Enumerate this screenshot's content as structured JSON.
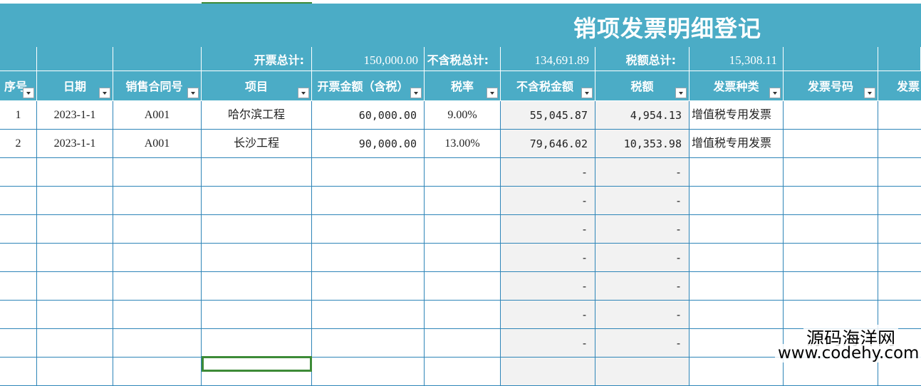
{
  "sheet_title": "销项发票明细登记",
  "summary": {
    "total_label": "开票总计:",
    "total_value": "150,000.00",
    "excl_tax_label": "不含税总计:",
    "excl_tax_value": "134,691.89",
    "tax_label": "税额总计:",
    "tax_value": "15,308.11"
  },
  "headers": {
    "seq": "序号",
    "date": "日期",
    "contract": "销售合同号",
    "project": "项目",
    "amount_incl": "开票金额（含税）",
    "rate": "税率",
    "amount_excl": "不含税金额",
    "tax": "税额",
    "invoice_type": "发票种类",
    "invoice_no": "发票号码",
    "more": "发票"
  },
  "rows": [
    {
      "seq": "1",
      "date": "2023-1-1",
      "contract": "A001",
      "project": "哈尔滨工程",
      "amount_incl": "60,000.00",
      "rate": "9.00%",
      "amount_excl": "55,045.87",
      "tax": "4,954.13",
      "invoice_type": "增值税专用发票",
      "invoice_no": "",
      "more": ""
    },
    {
      "seq": "2",
      "date": "2023-1-1",
      "contract": "A001",
      "project": "长沙工程",
      "amount_incl": "90,000.00",
      "rate": "13.00%",
      "amount_excl": "79,646.02",
      "tax": "10,353.98",
      "invoice_type": "增值税专用发票",
      "invoice_no": "",
      "more": ""
    },
    {
      "seq": "",
      "date": "",
      "contract": "",
      "project": "",
      "amount_incl": "",
      "rate": "",
      "amount_excl": "-",
      "tax": "-",
      "invoice_type": "",
      "invoice_no": "",
      "more": ""
    },
    {
      "seq": "",
      "date": "",
      "contract": "",
      "project": "",
      "amount_incl": "",
      "rate": "",
      "amount_excl": "-",
      "tax": "-",
      "invoice_type": "",
      "invoice_no": "",
      "more": ""
    },
    {
      "seq": "",
      "date": "",
      "contract": "",
      "project": "",
      "amount_incl": "",
      "rate": "",
      "amount_excl": "-",
      "tax": "-",
      "invoice_type": "",
      "invoice_no": "",
      "more": ""
    },
    {
      "seq": "",
      "date": "",
      "contract": "",
      "project": "",
      "amount_incl": "",
      "rate": "",
      "amount_excl": "-",
      "tax": "-",
      "invoice_type": "",
      "invoice_no": "",
      "more": ""
    },
    {
      "seq": "",
      "date": "",
      "contract": "",
      "project": "",
      "amount_incl": "",
      "rate": "",
      "amount_excl": "-",
      "tax": "-",
      "invoice_type": "",
      "invoice_no": "",
      "more": ""
    },
    {
      "seq": "",
      "date": "",
      "contract": "",
      "project": "",
      "amount_incl": "",
      "rate": "",
      "amount_excl": "-",
      "tax": "-",
      "invoice_type": "",
      "invoice_no": "",
      "more": ""
    },
    {
      "seq": "",
      "date": "",
      "contract": "",
      "project": "",
      "amount_incl": "",
      "rate": "",
      "amount_excl": "-",
      "tax": "-",
      "invoice_type": "",
      "invoice_no": "",
      "more": ""
    },
    {
      "seq": "",
      "date": "",
      "contract": "",
      "project": "",
      "amount_incl": "",
      "rate": "",
      "amount_excl": "",
      "tax": "",
      "invoice_type": "",
      "invoice_no": "",
      "more": ""
    }
  ],
  "watermark": {
    "line1": "源码海洋网",
    "line2": "www.codehy.com"
  },
  "colors": {
    "header_bg": "#4bacc6",
    "grid_line": "#2e85b8",
    "selection": "#3d8b37",
    "grey_cell": "#f2f2f2"
  }
}
